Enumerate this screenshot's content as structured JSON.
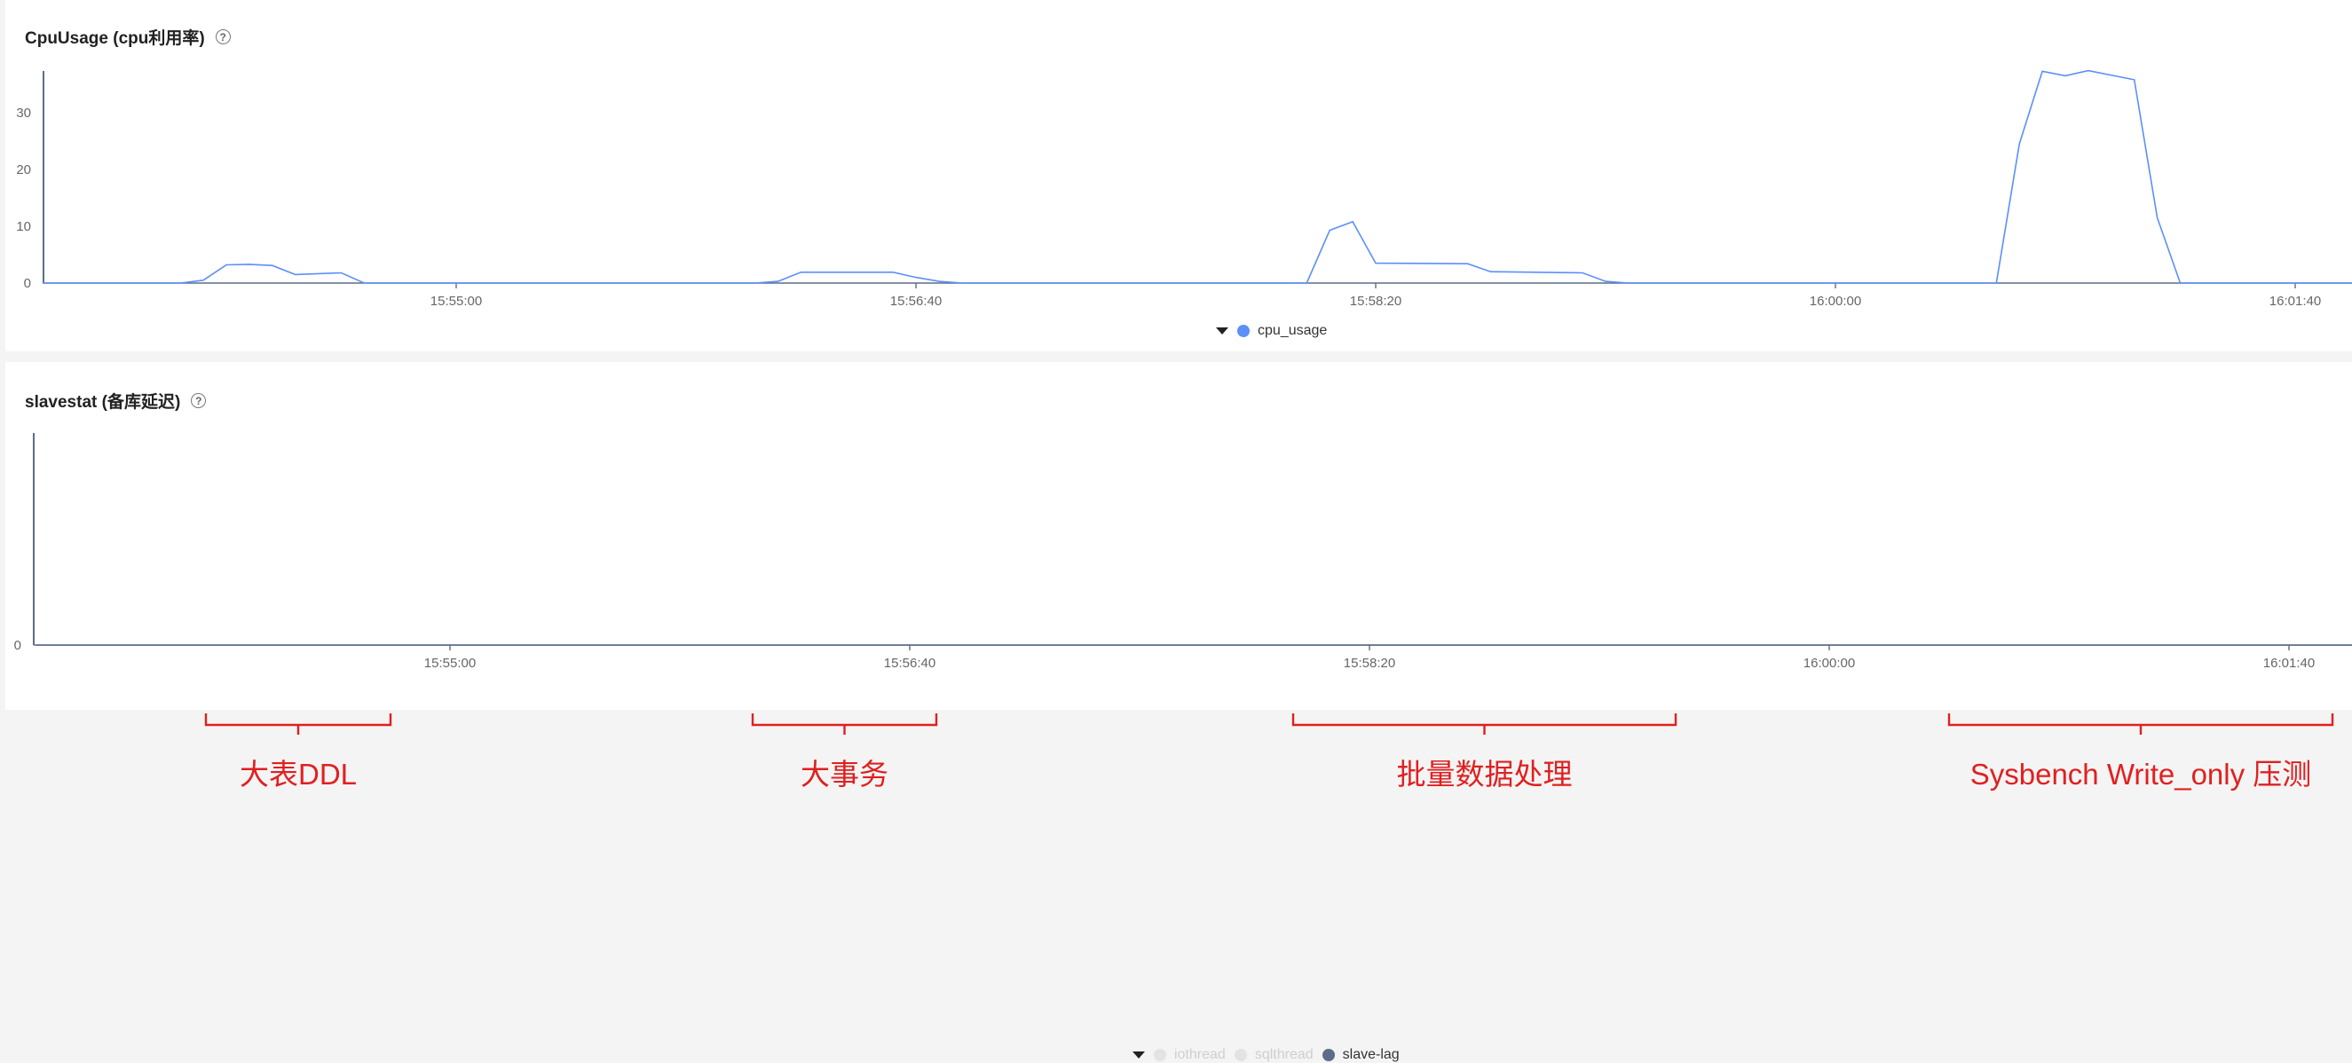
{
  "panels": [
    {
      "title": "CpuUsage (cpu利用率)",
      "help_icon": "question-circle-icon"
    },
    {
      "title": "slavestat (备库延迟)",
      "help_icon": "question-circle-icon"
    }
  ],
  "chart_data": [
    {
      "type": "line",
      "title": "CpuUsage (cpu利用率)",
      "x_ticks": [
        "15:55:00",
        "15:56:40",
        "15:58:20",
        "16:00:00",
        "16:01:40"
      ],
      "y_ticks": [
        0,
        10,
        20,
        30
      ],
      "ylim": [
        0,
        38
      ],
      "grid": false,
      "legend": "bottom-center",
      "series": [
        {
          "name": "cpu_usage",
          "color": "#5b8ff9",
          "points": [
            [
              "15:53:30",
              0
            ],
            [
              "15:54:00",
              0
            ],
            [
              "15:54:05",
              0.5
            ],
            [
              "15:54:10",
              3.2
            ],
            [
              "15:54:15",
              3.3
            ],
            [
              "15:54:20",
              3.1
            ],
            [
              "15:54:25",
              1.5
            ],
            [
              "15:54:35",
              1.8
            ],
            [
              "15:54:40",
              0
            ],
            [
              "15:56:05",
              0
            ],
            [
              "15:56:10",
              0.3
            ],
            [
              "15:56:15",
              1.9
            ],
            [
              "15:56:30",
              1.9
            ],
            [
              "15:56:35",
              1.9
            ],
            [
              "15:56:40",
              1.0
            ],
            [
              "15:56:45",
              0.3
            ],
            [
              "15:56:50",
              0
            ],
            [
              "15:58:05",
              0
            ],
            [
              "15:58:10",
              9.3
            ],
            [
              "15:58:15",
              10.8
            ],
            [
              "15:58:20",
              3.5
            ],
            [
              "15:58:40",
              3.4
            ],
            [
              "15:58:45",
              2.0
            ],
            [
              "15:59:05",
              1.8
            ],
            [
              "15:59:10",
              0.3
            ],
            [
              "15:59:15",
              0
            ],
            [
              "16:00:35",
              0
            ],
            [
              "16:00:40",
              24.5
            ],
            [
              "16:00:45",
              37.3
            ],
            [
              "16:00:50",
              36.5
            ],
            [
              "16:00:55",
              37.4
            ],
            [
              "16:01:05",
              35.8
            ],
            [
              "16:01:10",
              11.5
            ],
            [
              "16:01:15",
              0
            ],
            [
              "16:01:55",
              0
            ]
          ]
        }
      ]
    },
    {
      "type": "line",
      "title": "slavestat (备库延迟)",
      "x_ticks": [
        "15:55:00",
        "15:56:40",
        "15:58:20",
        "16:00:00",
        "16:01:40"
      ],
      "y_ticks": [
        0
      ],
      "grid": false,
      "legend": "bottom-center",
      "series": [
        {
          "name": "iothread",
          "color": "#e3e3e3",
          "visible": false,
          "points": []
        },
        {
          "name": "sqlthread",
          "color": "#e3e3e3",
          "visible": false,
          "points": []
        },
        {
          "name": "slave-lag",
          "color": "#5d6d89",
          "visible": true,
          "points": [
            [
              "15:53:30",
              0
            ],
            [
              "16:01:55",
              0
            ]
          ]
        }
      ]
    }
  ],
  "annotations": [
    {
      "label": "大表DDL",
      "color": "#e02020"
    },
    {
      "label": "大事务",
      "color": "#e02020"
    },
    {
      "label": "批量数据处理",
      "color": "#e02020"
    },
    {
      "label": "Sysbench Write_only 压测",
      "color": "#e02020"
    }
  ]
}
